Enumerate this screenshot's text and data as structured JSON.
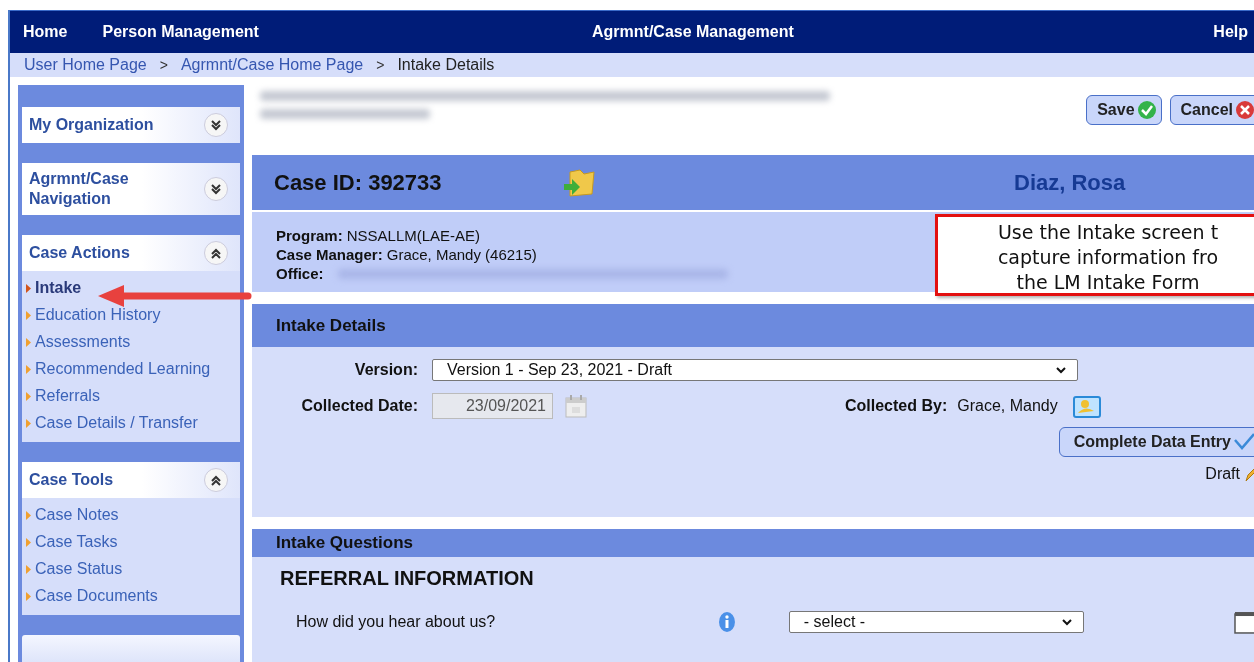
{
  "nav": {
    "items": [
      {
        "label": "Home"
      },
      {
        "label": "Person Management"
      }
    ],
    "title": "Agrmnt/Case Management",
    "help": "Help"
  },
  "breadcrumb": {
    "separator": ">",
    "items": [
      {
        "label": "User Home Page",
        "kind": "link"
      },
      {
        "label": "Agrmnt/Case Home Page",
        "kind": "link"
      },
      {
        "label": "Intake Details",
        "kind": "current"
      }
    ]
  },
  "sidebar": {
    "panels": [
      {
        "title": "My Organization",
        "expanded": false
      },
      {
        "title": "Agrmnt/Case Navigation",
        "expanded": false
      },
      {
        "title": "Case Actions",
        "expanded": true,
        "items": [
          {
            "label": "Intake",
            "selected": true
          },
          {
            "label": "Education History",
            "selected": false
          },
          {
            "label": "Assessments",
            "selected": false
          },
          {
            "label": "Recommended Learning",
            "selected": false
          },
          {
            "label": "Referrals",
            "selected": false
          },
          {
            "label": "Case Details / Transfer",
            "selected": false
          }
        ]
      },
      {
        "title": "Case Tools",
        "expanded": true,
        "items": [
          {
            "label": "Case Notes",
            "selected": false
          },
          {
            "label": "Case Tasks",
            "selected": false
          },
          {
            "label": "Case Status",
            "selected": false
          },
          {
            "label": "Case Documents",
            "selected": false
          }
        ]
      }
    ]
  },
  "toolbar": {
    "buttons": [
      {
        "label": "Save",
        "kind": "save"
      },
      {
        "label": "Cancel",
        "kind": "cancel"
      }
    ]
  },
  "case": {
    "id_label": "Case ID:",
    "id": "392733",
    "client": "Diaz, Rosa",
    "fields": [
      {
        "label": "Program:",
        "value": "NSSALLM(LAE-AE)"
      },
      {
        "label": "Case Manager:",
        "value": "Grace, Mandy (46215)"
      },
      {
        "label": "Office:"
      }
    ]
  },
  "intake_details": {
    "title": "Intake Details",
    "version_label": "Version:",
    "version": "Version 1 - Sep 23, 2021 - Draft",
    "collected_date_label": "Collected Date:",
    "collected_date": {
      "value": "23/09/2021",
      "disabled": true
    },
    "collected_by_label": "Collected By:",
    "collected_by": "Grace, Mandy",
    "complete_button": "Complete Data Entry",
    "status": "Draft"
  },
  "intake_questions": {
    "title": "Intake Questions",
    "section": "REFERRAL INFORMATION",
    "questions": [
      {
        "text": "How did you hear about us?",
        "value": "- select -"
      }
    ]
  },
  "callout": {
    "text": "Use the Intake screen t\ncapture information fro\nthe LM Intake Form"
  }
}
